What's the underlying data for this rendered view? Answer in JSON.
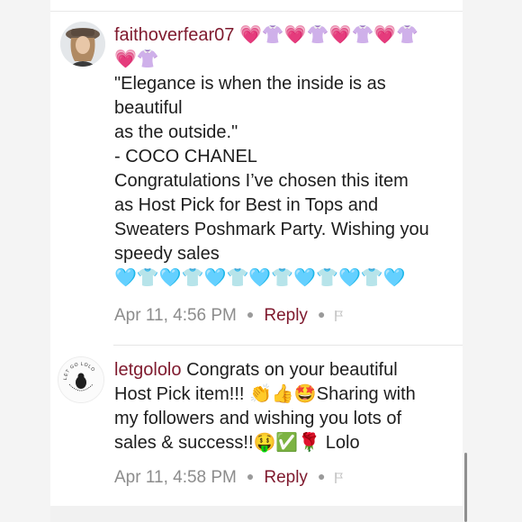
{
  "comments": [
    {
      "username": "faithoverfear07",
      "lines": [
        "💗👚💗👚💗👚💗👚",
        "💗👚",
        "\"Elegance is when the inside is as",
        "beautiful",
        "as the outside.\"",
        "- COCO CHANEL",
        "Congratulations I’ve chosen this item",
        "as Host Pick for Best in Tops and",
        "Sweaters Poshmark Party. Wishing you",
        "speedy sales",
        "🩵👕🩵👕🩵👕🩵👕🩵👕🩵👕🩵"
      ],
      "timestamp": "Apr 11, 4:56 PM",
      "reply_label": "Reply"
    },
    {
      "username": "letgololo",
      "avatar_text": "LET GO LOLO",
      "lines": [
        "Congrats on your beautiful",
        "Host Pick item!!! 👏👍🤩Sharing with",
        "my followers and wishing you lots of",
        "sales & success!!🤑✅🌹 Lolo"
      ],
      "timestamp": "Apr 11, 4:58 PM",
      "reply_label": "Reply"
    }
  ],
  "colors": {
    "username": "#7f1a2e",
    "reply": "#7f1a2e",
    "text": "#1d1d1d",
    "meta": "#8c8c8c"
  }
}
